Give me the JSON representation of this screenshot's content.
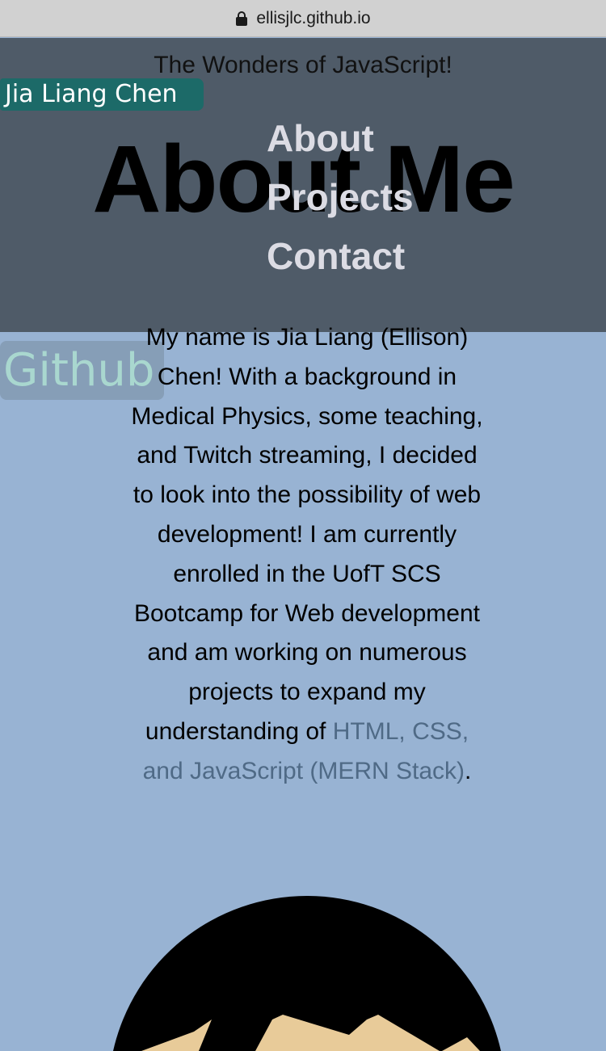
{
  "browser": {
    "url": "ellisjlc.github.io"
  },
  "header": {
    "tagline": "The Wonders of JavaScript!",
    "name": "Jia Liang Chen",
    "title": "About Me",
    "nav": [
      "About",
      "Projects",
      "Contact"
    ]
  },
  "github": {
    "label": "Github"
  },
  "bio": {
    "text": "My name is Jia Liang (Ellison) Chen! With a background in Medical Physics, some teaching, and Twitch streaming, I decided to look into the possibility of web development! I am currently enrolled in the UofT SCS Bootcamp for Web development and am working on numerous projects to expand my understanding of ",
    "link_text": "HTML, CSS, and JavaScript (MERN Stack)",
    "end": "."
  },
  "colors": {
    "header_bg": "#4f5b68",
    "page_bg": "#98b3d3",
    "name_badge": "#1c6a68",
    "link": "#4f6a86"
  }
}
